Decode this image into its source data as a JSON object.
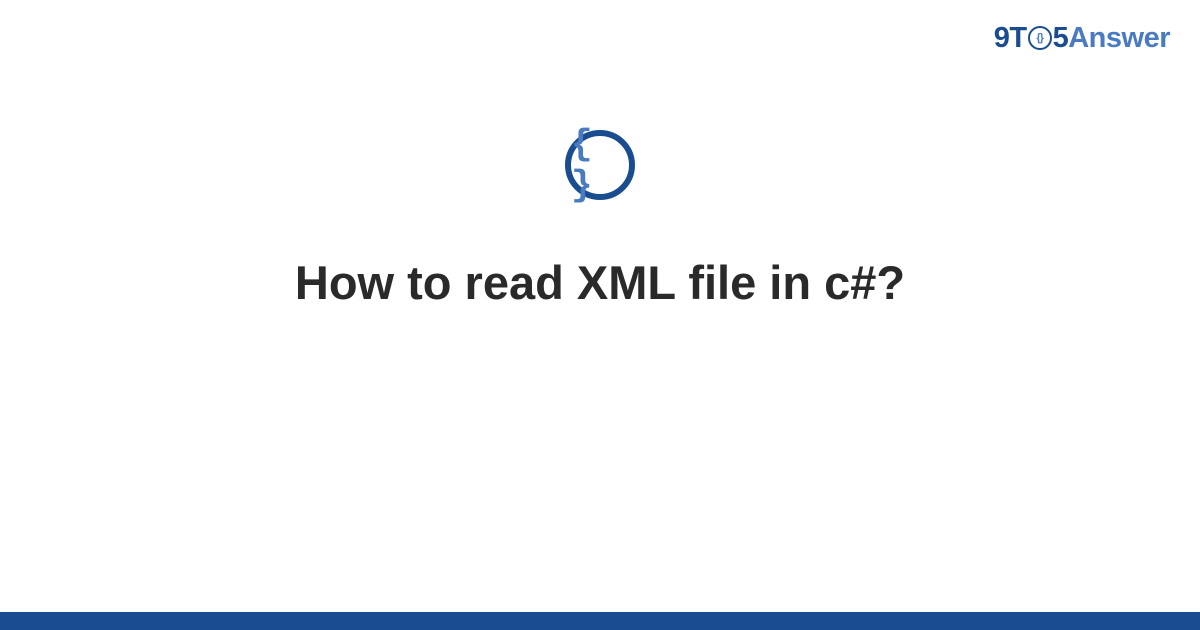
{
  "logo": {
    "part1": "9T",
    "part_o_inner": "{}",
    "part2": "5",
    "part3": "Answer"
  },
  "category": {
    "icon_label": "{ }"
  },
  "title": "How to read XML file in c#?",
  "colors": {
    "primary": "#1a4d8f",
    "secondary": "#4a7bc0",
    "text": "#2a2a2a"
  }
}
